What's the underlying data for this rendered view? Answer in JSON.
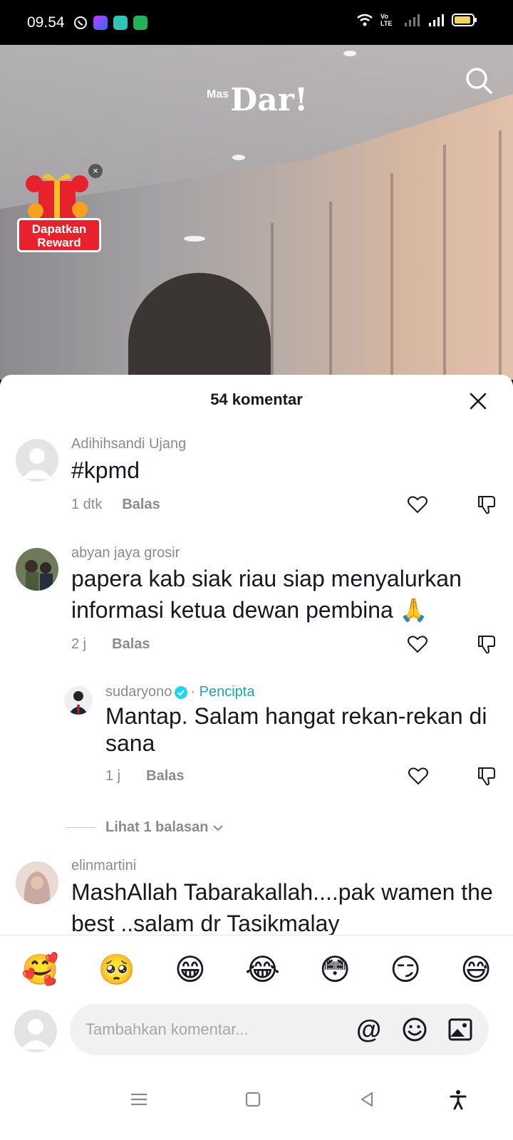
{
  "status_bar": {
    "time": "09.54",
    "network_label": "Vo LTE"
  },
  "video": {
    "logo_small": "Mas",
    "logo_main": "Dar!"
  },
  "reward": {
    "label_line1": "Dapatkan",
    "label_line2": "Reward",
    "close_glyph": "×"
  },
  "sheet": {
    "title": "54 komentar"
  },
  "comments": [
    {
      "name": "Adihihsandi Ujang",
      "text": "#kpmd",
      "time": "1 dtk",
      "reply": "Balas"
    },
    {
      "name": "abyan jaya grosir",
      "text": "papera kab siak riau siap menyalurkan informasi ketua dewan pembina 🙏",
      "time": "2 j",
      "reply": "Balas"
    },
    {
      "name": "sudaryono",
      "separator": "·",
      "badge": "Pencipta",
      "text": "Mantap. Salam hangat rekan-rekan di sana",
      "time": "1 j",
      "reply": "Balas"
    },
    {
      "name": "elinmartini",
      "text": "MashAllah Tabarakallah....pak wamen the best ..salam dr Tasikmalay"
    }
  ],
  "view_replies": {
    "label": "Lihat 1 balasan"
  },
  "composer": {
    "emojis": [
      "🥰",
      "🥺",
      "😁",
      "😂",
      "😳",
      "😏",
      "😅"
    ],
    "placeholder": "Tambahkan komentar...",
    "at_symbol": "@"
  },
  "colors": {
    "accent_creator": "#1da2b5",
    "verified": "#20d5ec",
    "reward_red": "#e8222d"
  }
}
